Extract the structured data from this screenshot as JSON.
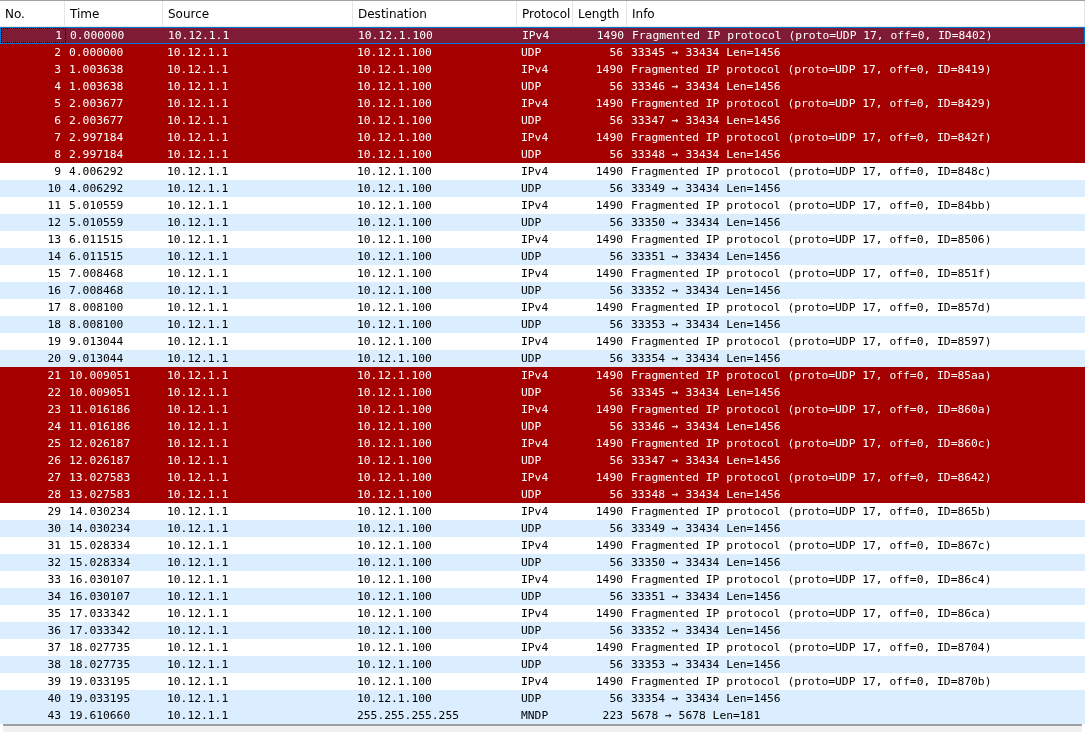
{
  "table": {
    "columns": [
      "No.",
      "Time",
      "Source",
      "Destination",
      "Protocol",
      "Length",
      "Info"
    ],
    "rows": [
      {
        "no": "1",
        "time": "0.000000",
        "source": "10.12.1.1",
        "destination": "10.12.1.100",
        "protocol": "IPv4",
        "length": "1490",
        "info": "Fragmented IP protocol (proto=UDP 17, off=0, ID=8402)",
        "color": "#7f1b34",
        "selected": true
      },
      {
        "no": "2",
        "time": "0.000000",
        "source": "10.12.1.1",
        "destination": "10.12.1.100",
        "protocol": "UDP",
        "length": "56",
        "info": "33345 → 33434 Len=1456",
        "color": "#a40000",
        "selected": false
      },
      {
        "no": "3",
        "time": "1.003638",
        "source": "10.12.1.1",
        "destination": "10.12.1.100",
        "protocol": "IPv4",
        "length": "1490",
        "info": "Fragmented IP protocol (proto=UDP 17, off=0, ID=8419)",
        "color": "#a40000",
        "selected": false
      },
      {
        "no": "4",
        "time": "1.003638",
        "source": "10.12.1.1",
        "destination": "10.12.1.100",
        "protocol": "UDP",
        "length": "56",
        "info": "33346 → 33434 Len=1456",
        "color": "#a40000",
        "selected": false
      },
      {
        "no": "5",
        "time": "2.003677",
        "source": "10.12.1.1",
        "destination": "10.12.1.100",
        "protocol": "IPv4",
        "length": "1490",
        "info": "Fragmented IP protocol (proto=UDP 17, off=0, ID=8429)",
        "color": "#a40000",
        "selected": false
      },
      {
        "no": "6",
        "time": "2.003677",
        "source": "10.12.1.1",
        "destination": "10.12.1.100",
        "protocol": "UDP",
        "length": "56",
        "info": "33347 → 33434 Len=1456",
        "color": "#a40000",
        "selected": false
      },
      {
        "no": "7",
        "time": "2.997184",
        "source": "10.12.1.1",
        "destination": "10.12.1.100",
        "protocol": "IPv4",
        "length": "1490",
        "info": "Fragmented IP protocol (proto=UDP 17, off=0, ID=842f)",
        "color": "#a40000",
        "selected": false
      },
      {
        "no": "8",
        "time": "2.997184",
        "source": "10.12.1.1",
        "destination": "10.12.1.100",
        "protocol": "UDP",
        "length": "56",
        "info": "33348 → 33434 Len=1456",
        "color": "#a40000",
        "selected": false
      },
      {
        "no": "9",
        "time": "4.006292",
        "source": "10.12.1.1",
        "destination": "10.12.1.100",
        "protocol": "IPv4",
        "length": "1490",
        "info": "Fragmented IP protocol (proto=UDP 17, off=0, ID=848c)",
        "color": "#ffffff",
        "selected": false
      },
      {
        "no": "10",
        "time": "4.006292",
        "source": "10.12.1.1",
        "destination": "10.12.1.100",
        "protocol": "UDP",
        "length": "56",
        "info": "33349 → 33434 Len=1456",
        "color": "#daeeff",
        "selected": false
      },
      {
        "no": "11",
        "time": "5.010559",
        "source": "10.12.1.1",
        "destination": "10.12.1.100",
        "protocol": "IPv4",
        "length": "1490",
        "info": "Fragmented IP protocol (proto=UDP 17, off=0, ID=84bb)",
        "color": "#ffffff",
        "selected": false
      },
      {
        "no": "12",
        "time": "5.010559",
        "source": "10.12.1.1",
        "destination": "10.12.1.100",
        "protocol": "UDP",
        "length": "56",
        "info": "33350 → 33434 Len=1456",
        "color": "#daeeff",
        "selected": false
      },
      {
        "no": "13",
        "time": "6.011515",
        "source": "10.12.1.1",
        "destination": "10.12.1.100",
        "protocol": "IPv4",
        "length": "1490",
        "info": "Fragmented IP protocol (proto=UDP 17, off=0, ID=8506)",
        "color": "#ffffff",
        "selected": false
      },
      {
        "no": "14",
        "time": "6.011515",
        "source": "10.12.1.1",
        "destination": "10.12.1.100",
        "protocol": "UDP",
        "length": "56",
        "info": "33351 → 33434 Len=1456",
        "color": "#daeeff",
        "selected": false
      },
      {
        "no": "15",
        "time": "7.008468",
        "source": "10.12.1.1",
        "destination": "10.12.1.100",
        "protocol": "IPv4",
        "length": "1490",
        "info": "Fragmented IP protocol (proto=UDP 17, off=0, ID=851f)",
        "color": "#ffffff",
        "selected": false
      },
      {
        "no": "16",
        "time": "7.008468",
        "source": "10.12.1.1",
        "destination": "10.12.1.100",
        "protocol": "UDP",
        "length": "56",
        "info": "33352 → 33434 Len=1456",
        "color": "#daeeff",
        "selected": false
      },
      {
        "no": "17",
        "time": "8.008100",
        "source": "10.12.1.1",
        "destination": "10.12.1.100",
        "protocol": "IPv4",
        "length": "1490",
        "info": "Fragmented IP protocol (proto=UDP 17, off=0, ID=857d)",
        "color": "#ffffff",
        "selected": false
      },
      {
        "no": "18",
        "time": "8.008100",
        "source": "10.12.1.1",
        "destination": "10.12.1.100",
        "protocol": "UDP",
        "length": "56",
        "info": "33353 → 33434 Len=1456",
        "color": "#daeeff",
        "selected": false
      },
      {
        "no": "19",
        "time": "9.013044",
        "source": "10.12.1.1",
        "destination": "10.12.1.100",
        "protocol": "IPv4",
        "length": "1490",
        "info": "Fragmented IP protocol (proto=UDP 17, off=0, ID=8597)",
        "color": "#ffffff",
        "selected": false
      },
      {
        "no": "20",
        "time": "9.013044",
        "source": "10.12.1.1",
        "destination": "10.12.1.100",
        "protocol": "UDP",
        "length": "56",
        "info": "33354 → 33434 Len=1456",
        "color": "#daeeff",
        "selected": false
      },
      {
        "no": "21",
        "time": "10.009051",
        "source": "10.12.1.1",
        "destination": "10.12.1.100",
        "protocol": "IPv4",
        "length": "1490",
        "info": "Fragmented IP protocol (proto=UDP 17, off=0, ID=85aa)",
        "color": "#a40000",
        "selected": false
      },
      {
        "no": "22",
        "time": "10.009051",
        "source": "10.12.1.1",
        "destination": "10.12.1.100",
        "protocol": "UDP",
        "length": "56",
        "info": "33345 → 33434 Len=1456",
        "color": "#a40000",
        "selected": false
      },
      {
        "no": "23",
        "time": "11.016186",
        "source": "10.12.1.1",
        "destination": "10.12.1.100",
        "protocol": "IPv4",
        "length": "1490",
        "info": "Fragmented IP protocol (proto=UDP 17, off=0, ID=860a)",
        "color": "#a40000",
        "selected": false
      },
      {
        "no": "24",
        "time": "11.016186",
        "source": "10.12.1.1",
        "destination": "10.12.1.100",
        "protocol": "UDP",
        "length": "56",
        "info": "33346 → 33434 Len=1456",
        "color": "#a40000",
        "selected": false
      },
      {
        "no": "25",
        "time": "12.026187",
        "source": "10.12.1.1",
        "destination": "10.12.1.100",
        "protocol": "IPv4",
        "length": "1490",
        "info": "Fragmented IP protocol (proto=UDP 17, off=0, ID=860c)",
        "color": "#a40000",
        "selected": false
      },
      {
        "no": "26",
        "time": "12.026187",
        "source": "10.12.1.1",
        "destination": "10.12.1.100",
        "protocol": "UDP",
        "length": "56",
        "info": "33347 → 33434 Len=1456",
        "color": "#a40000",
        "selected": false
      },
      {
        "no": "27",
        "time": "13.027583",
        "source": "10.12.1.1",
        "destination": "10.12.1.100",
        "protocol": "IPv4",
        "length": "1490",
        "info": "Fragmented IP protocol (proto=UDP 17, off=0, ID=8642)",
        "color": "#a40000",
        "selected": false
      },
      {
        "no": "28",
        "time": "13.027583",
        "source": "10.12.1.1",
        "destination": "10.12.1.100",
        "protocol": "UDP",
        "length": "56",
        "info": "33348 → 33434 Len=1456",
        "color": "#a40000",
        "selected": false
      },
      {
        "no": "29",
        "time": "14.030234",
        "source": "10.12.1.1",
        "destination": "10.12.1.100",
        "protocol": "IPv4",
        "length": "1490",
        "info": "Fragmented IP protocol (proto=UDP 17, off=0, ID=865b)",
        "color": "#ffffff",
        "selected": false
      },
      {
        "no": "30",
        "time": "14.030234",
        "source": "10.12.1.1",
        "destination": "10.12.1.100",
        "protocol": "UDP",
        "length": "56",
        "info": "33349 → 33434 Len=1456",
        "color": "#daeeff",
        "selected": false
      },
      {
        "no": "31",
        "time": "15.028334",
        "source": "10.12.1.1",
        "destination": "10.12.1.100",
        "protocol": "IPv4",
        "length": "1490",
        "info": "Fragmented IP protocol (proto=UDP 17, off=0, ID=867c)",
        "color": "#ffffff",
        "selected": false
      },
      {
        "no": "32",
        "time": "15.028334",
        "source": "10.12.1.1",
        "destination": "10.12.1.100",
        "protocol": "UDP",
        "length": "56",
        "info": "33350 → 33434 Len=1456",
        "color": "#daeeff",
        "selected": false
      },
      {
        "no": "33",
        "time": "16.030107",
        "source": "10.12.1.1",
        "destination": "10.12.1.100",
        "protocol": "IPv4",
        "length": "1490",
        "info": "Fragmented IP protocol (proto=UDP 17, off=0, ID=86c4)",
        "color": "#ffffff",
        "selected": false
      },
      {
        "no": "34",
        "time": "16.030107",
        "source": "10.12.1.1",
        "destination": "10.12.1.100",
        "protocol": "UDP",
        "length": "56",
        "info": "33351 → 33434 Len=1456",
        "color": "#daeeff",
        "selected": false
      },
      {
        "no": "35",
        "time": "17.033342",
        "source": "10.12.1.1",
        "destination": "10.12.1.100",
        "protocol": "IPv4",
        "length": "1490",
        "info": "Fragmented IP protocol (proto=UDP 17, off=0, ID=86ca)",
        "color": "#ffffff",
        "selected": false
      },
      {
        "no": "36",
        "time": "17.033342",
        "source": "10.12.1.1",
        "destination": "10.12.1.100",
        "protocol": "UDP",
        "length": "56",
        "info": "33352 → 33434 Len=1456",
        "color": "#daeeff",
        "selected": false
      },
      {
        "no": "37",
        "time": "18.027735",
        "source": "10.12.1.1",
        "destination": "10.12.1.100",
        "protocol": "IPv4",
        "length": "1490",
        "info": "Fragmented IP protocol (proto=UDP 17, off=0, ID=8704)",
        "color": "#ffffff",
        "selected": false
      },
      {
        "no": "38",
        "time": "18.027735",
        "source": "10.12.1.1",
        "destination": "10.12.1.100",
        "protocol": "UDP",
        "length": "56",
        "info": "33353 → 33434 Len=1456",
        "color": "#daeeff",
        "selected": false
      },
      {
        "no": "39",
        "time": "19.033195",
        "source": "10.12.1.1",
        "destination": "10.12.1.100",
        "protocol": "IPv4",
        "length": "1490",
        "info": "Fragmented IP protocol (proto=UDP 17, off=0, ID=870b)",
        "color": "#ffffff",
        "selected": false
      },
      {
        "no": "40",
        "time": "19.033195",
        "source": "10.12.1.1",
        "destination": "10.12.1.100",
        "protocol": "UDP",
        "length": "56",
        "info": "33354 → 33434 Len=1456",
        "color": "#daeeff",
        "selected": false
      },
      {
        "no": "43",
        "time": "19.610660",
        "source": "10.12.1.1",
        "destination": "255.255.255.255",
        "protocol": "MNDP",
        "length": "223",
        "info": "5678 → 5678 Len=181",
        "color": "#daeeff",
        "selected": false
      }
    ]
  }
}
